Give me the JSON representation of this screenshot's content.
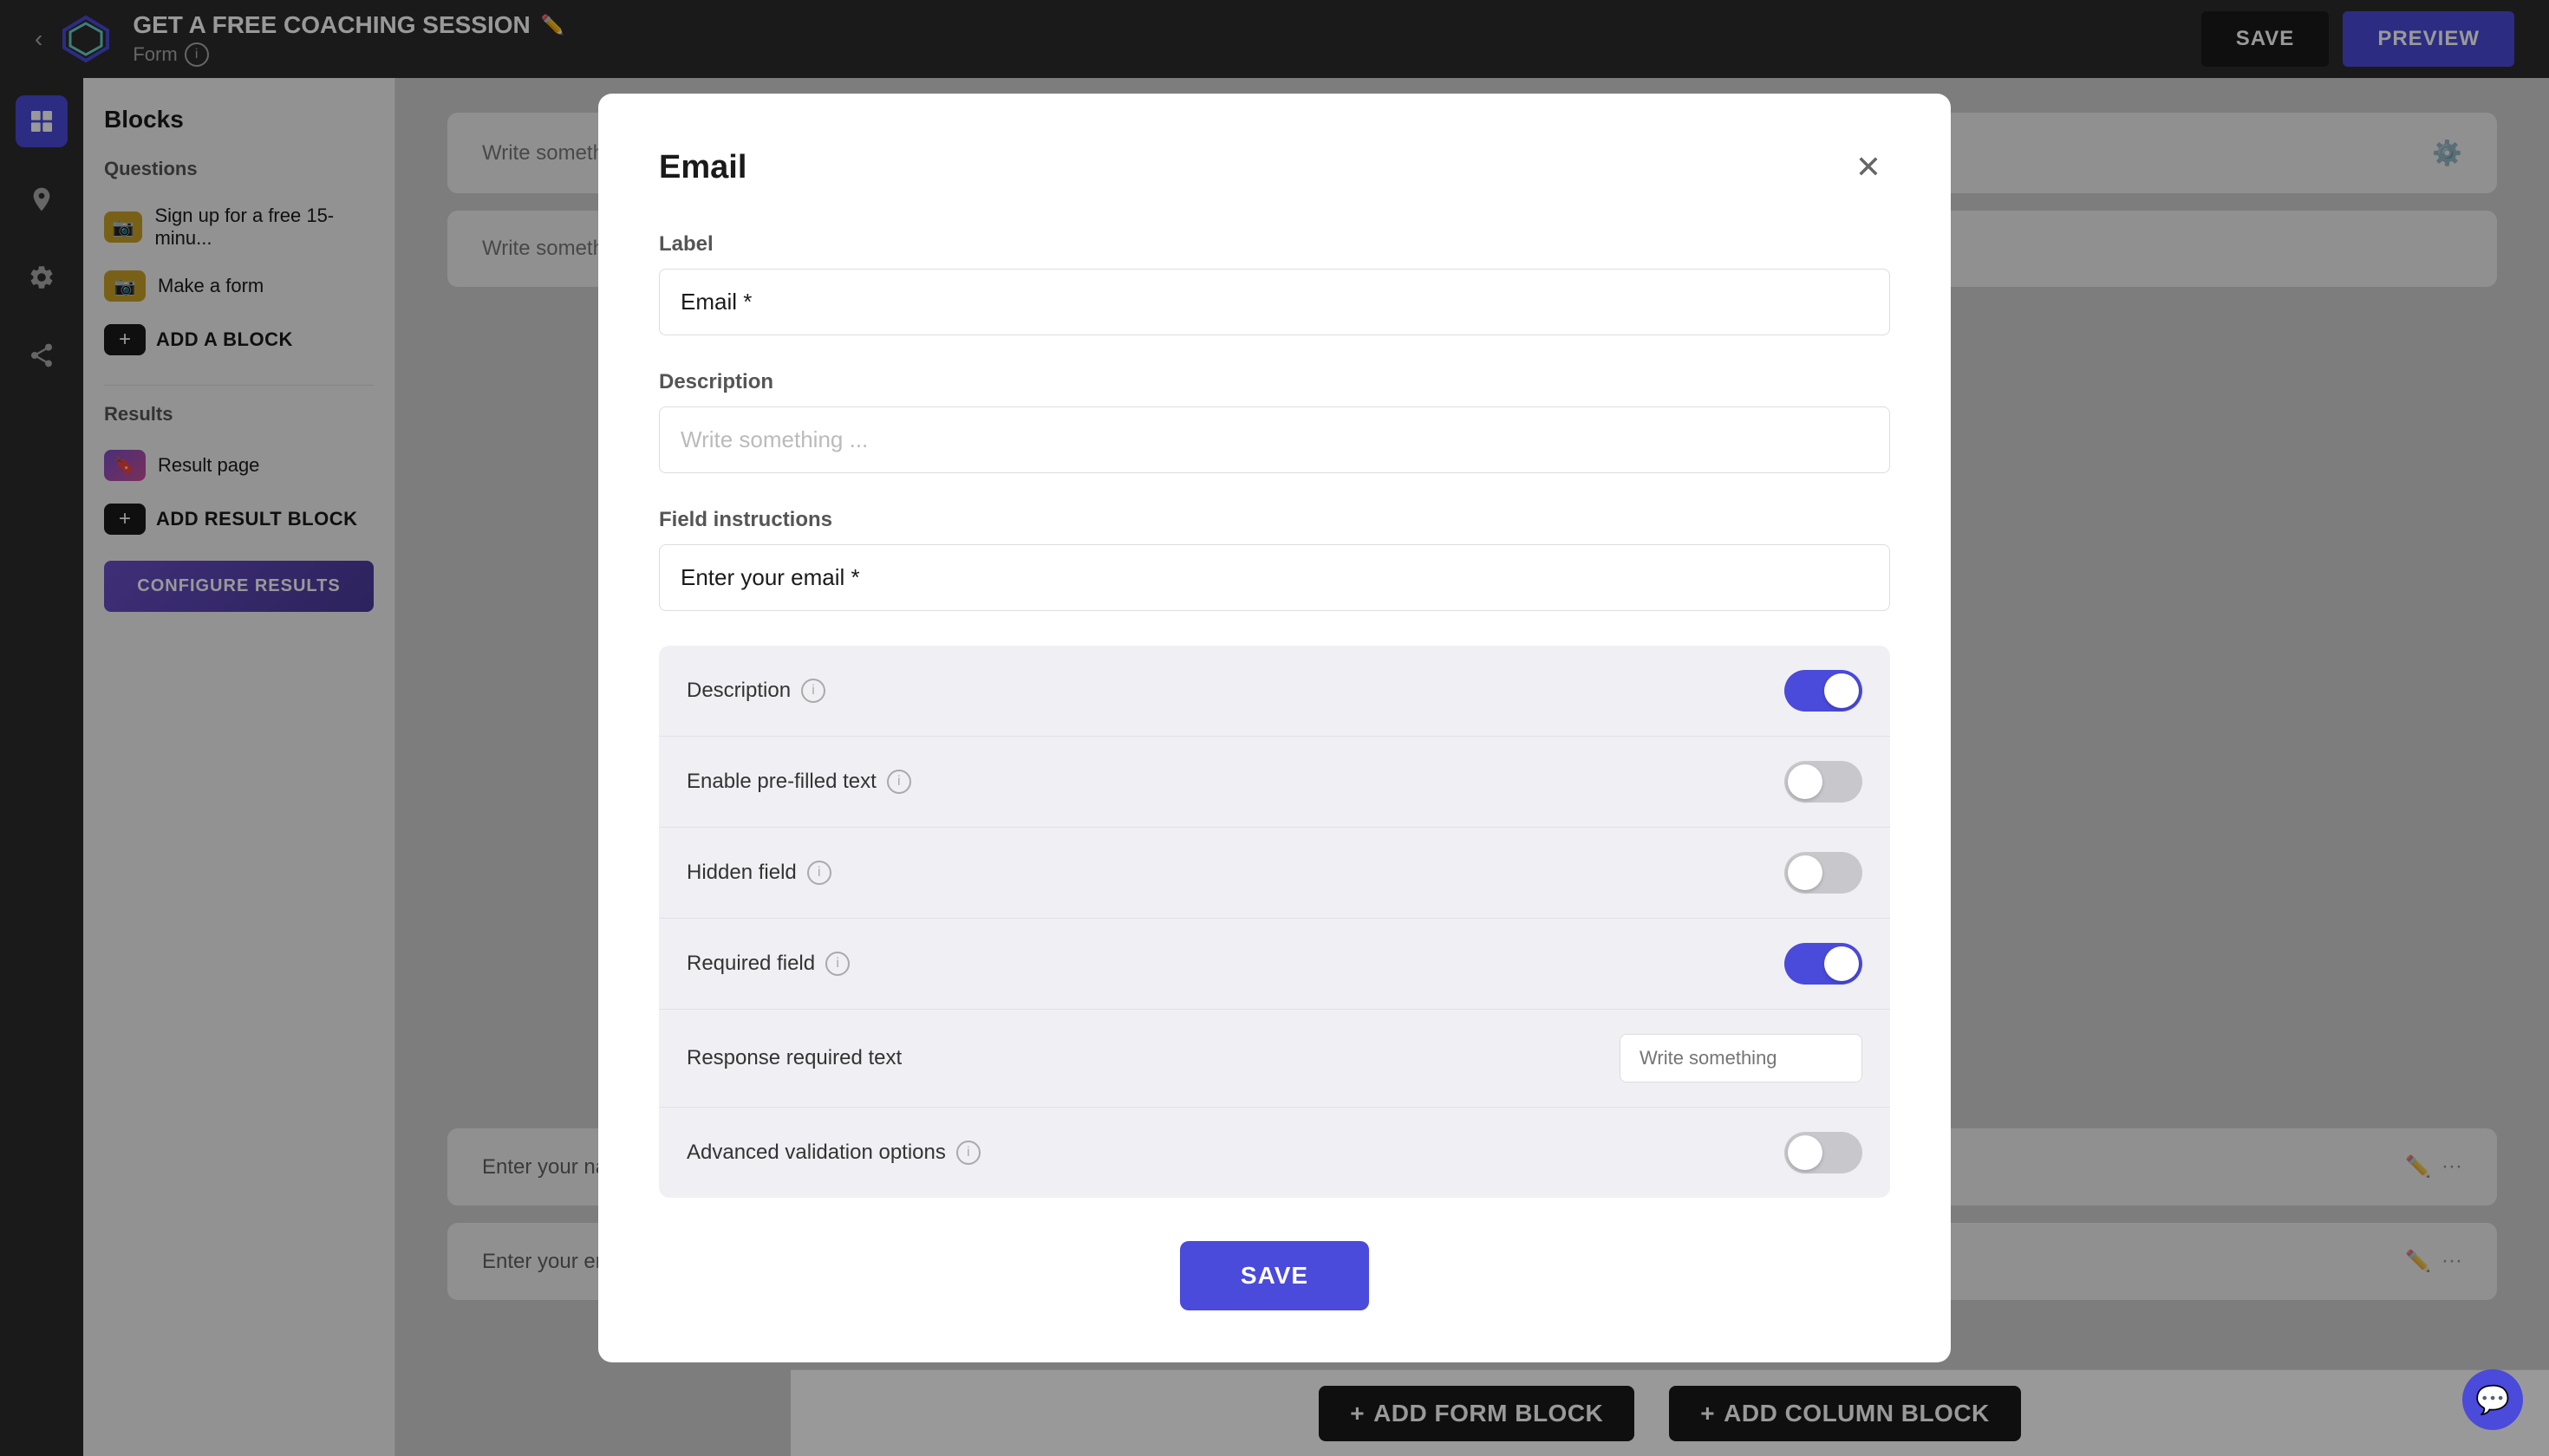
{
  "topbar": {
    "title": "GET A FREE COACHING SESSION",
    "subtitle": "Form",
    "save_label": "SAVE",
    "preview_label": "PREVIEW"
  },
  "sidebar": {
    "icons": [
      {
        "name": "grid-icon",
        "label": "Blocks",
        "active": true
      },
      {
        "name": "pin-icon",
        "label": "Pin",
        "active": false
      },
      {
        "name": "gear-icon",
        "label": "Settings",
        "active": false
      },
      {
        "name": "share-icon",
        "label": "Share",
        "active": false
      }
    ]
  },
  "left_panel": {
    "title": "Blocks",
    "sections": [
      {
        "label": "Questions",
        "items": [
          {
            "icon": "camera",
            "color": "yellow",
            "label": "Sign up for a free 15-minu..."
          },
          {
            "icon": "camera",
            "color": "yellow",
            "label": "Make a form"
          }
        ],
        "add_label": "ADD A BLOCK"
      },
      {
        "label": "Results",
        "items": [
          {
            "icon": "bookmark",
            "color": "purple",
            "label": "Result page"
          }
        ],
        "add_label": "ADD RESULT BLOCK"
      }
    ],
    "configure_label": "CONFIGURE RESULTS"
  },
  "modal": {
    "title": "Email",
    "label_field": {
      "label": "Label",
      "value": "Email *",
      "placeholder": "Email *"
    },
    "description_field": {
      "label": "Description",
      "placeholder": "Write something ..."
    },
    "field_instructions": {
      "label": "Field instructions",
      "value": "Enter your email *",
      "placeholder": "Enter your email *"
    },
    "toggles": [
      {
        "label": "Description",
        "has_info": true,
        "state": "on"
      },
      {
        "label": "Enable pre-filled text",
        "has_info": true,
        "state": "off"
      },
      {
        "label": "Hidden field",
        "has_info": true,
        "state": "off"
      },
      {
        "label": "Required field",
        "has_info": true,
        "state": "on"
      },
      {
        "label": "Response required text",
        "has_info": false,
        "state": "input",
        "input_placeholder": "Write something"
      },
      {
        "label": "Advanced validation options",
        "has_info": true,
        "state": "off"
      }
    ],
    "save_label": "SAVE"
  },
  "canvas": {
    "cards": [
      {
        "type": "heading",
        "text": "Write something",
        "has_gear": true
      },
      {
        "type": "description",
        "text": "Write something"
      },
      {
        "type": "field",
        "field_label": "Enter your name *",
        "has_actions": true
      },
      {
        "type": "field",
        "field_label": "Enter your email *",
        "has_actions": true
      }
    ],
    "bottom_buttons": [
      {
        "label": "ADD FORM BLOCK"
      },
      {
        "label": "ADD COLUMN BLOCK"
      }
    ]
  },
  "chat_button": {
    "icon": "💬"
  }
}
